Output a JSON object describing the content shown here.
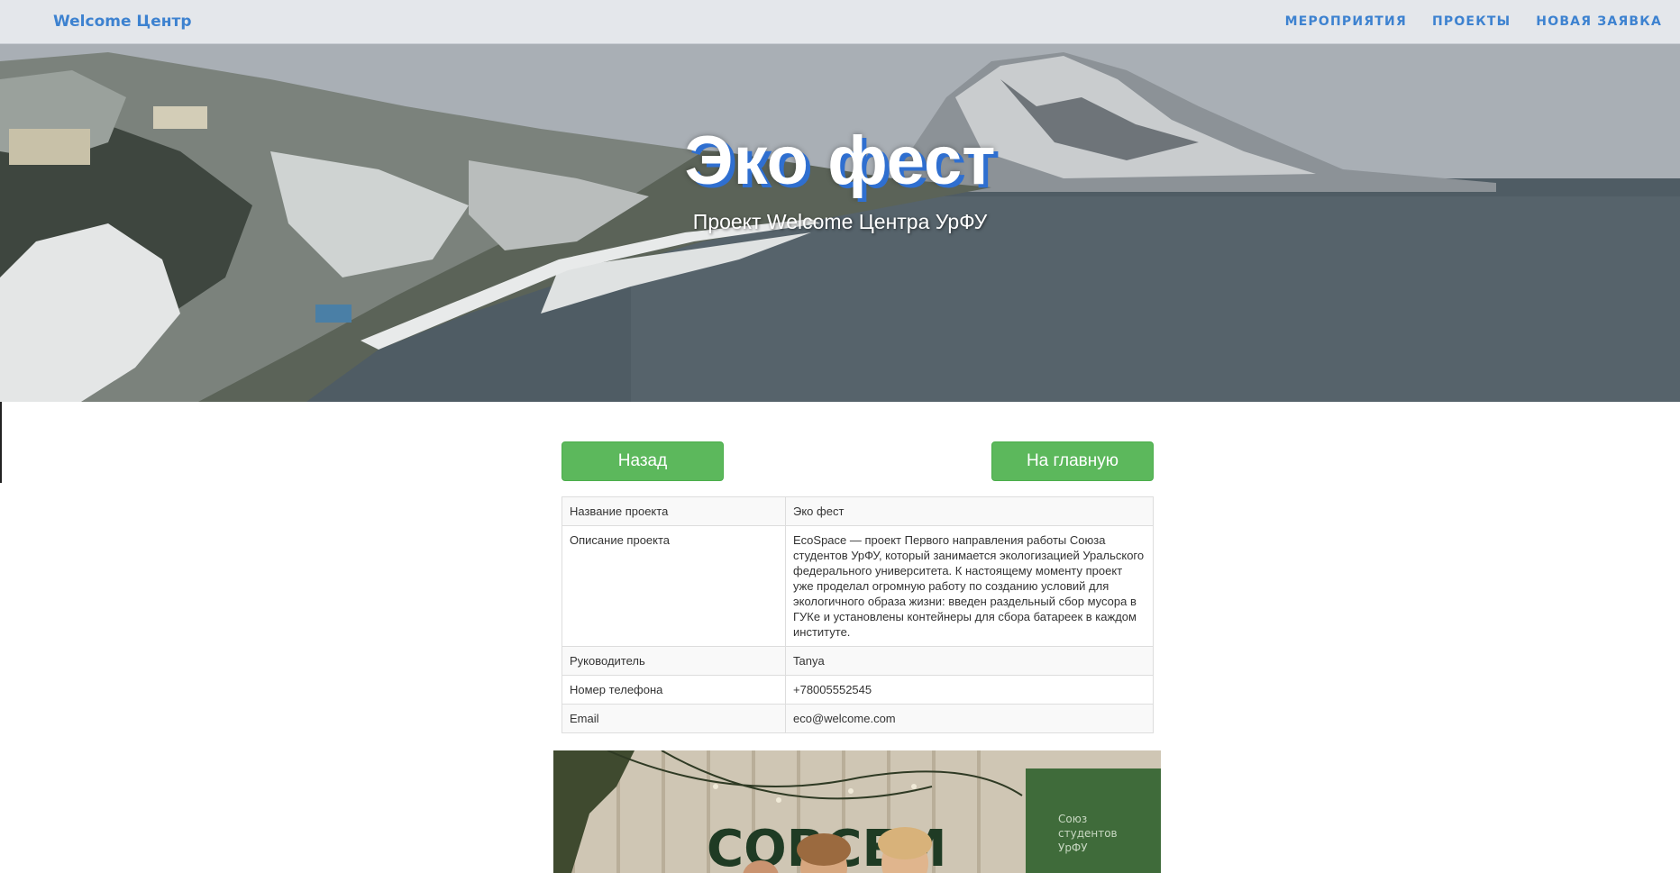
{
  "navbar": {
    "brand": "Welcome Центр",
    "links": [
      "МЕРОПРИЯТИЯ",
      "ПРОЕКТЫ",
      "НОВАЯ ЗАЯВКА"
    ]
  },
  "hero": {
    "title": "Эко фест",
    "subtitle": "Проект Welcome Центра УрФУ"
  },
  "buttons": {
    "back": "Назад",
    "home": "На главную"
  },
  "table": {
    "rows": [
      {
        "label": "Название проекта",
        "value": "Эко фест"
      },
      {
        "label": "Описание проекта",
        "value": "EcoSpace — проект Первого направления работы Союза студентов УрФУ, который занимается экологизацией Уральского федерального университета. К настоящему моменту проект уже проделал огромную работу по созданию условий для экологичного образа жизни: введен раздельный сбор мусора в ГУКе и установлены контейнеры для сбора батареек в каждом институте."
      },
      {
        "label": "Руководитель",
        "value": "Tanya"
      },
      {
        "label": "Номер телефона",
        "value": "+78005552545"
      },
      {
        "label": "Email",
        "value": "eco@welcome.com"
      }
    ]
  },
  "photo": {
    "sign_text": "СОВСЕМ",
    "badge_text": "Союз студентов УрФУ"
  },
  "colors": {
    "accent": "#3d82d0",
    "button": "#5cb85c"
  }
}
